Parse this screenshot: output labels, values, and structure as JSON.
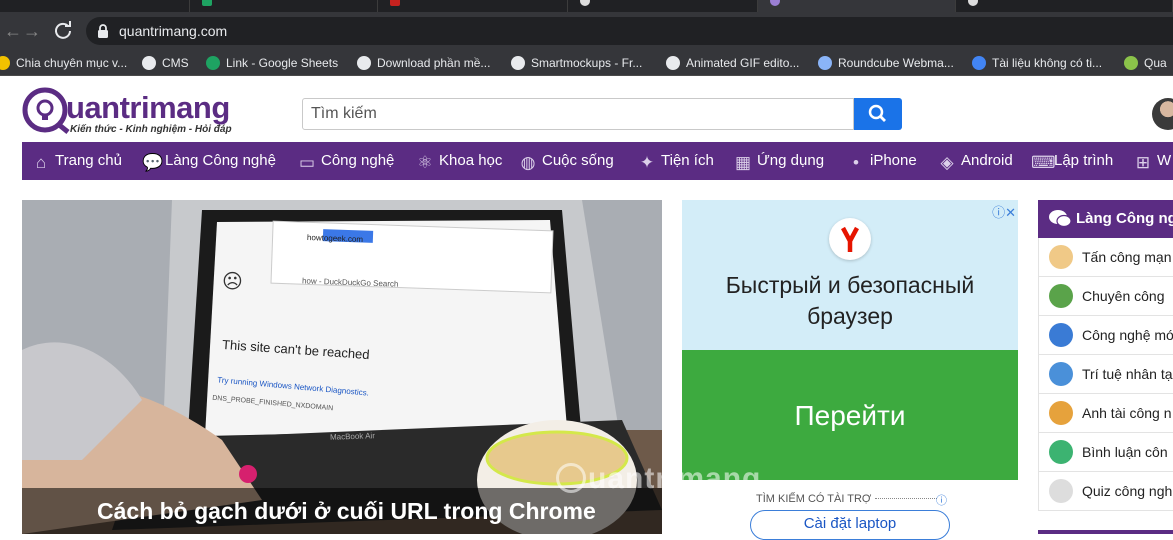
{
  "browser": {
    "url": "quantrimang.com",
    "bookmarks": [
      {
        "label": "Chia chuyên mục v...",
        "color": "#f2c200"
      },
      {
        "label": "CMS",
        "color": "#e8eaed"
      },
      {
        "label": "Link - Google Sheets",
        "color": "#1ea362"
      },
      {
        "label": "Download phần mề...",
        "color": "#e8eaed"
      },
      {
        "label": "Smartmockups - Fr...",
        "color": "#e8eaed"
      },
      {
        "label": "Animated GIF edito...",
        "color": "#e8eaed"
      },
      {
        "label": "Roundcube Webma...",
        "color": "#8ab4f8"
      },
      {
        "label": "Tài liệu không có ti...",
        "color": "#4285f4"
      },
      {
        "label": "Qua",
        "color": "#8bc34a"
      }
    ]
  },
  "site": {
    "logo_main": "uantrimang",
    "logo_tagline": "Kiến thức - Kinh nghiệm - Hỏi đáp",
    "search_placeholder": "Tìm kiếm",
    "nav": [
      {
        "label": "Trang chủ",
        "icon": "home-icon"
      },
      {
        "label": "Làng Công nghệ",
        "icon": "chat-bubbles-icon"
      },
      {
        "label": "Công nghệ",
        "icon": "monitor-icon"
      },
      {
        "label": "Khoa học",
        "icon": "atom-icon"
      },
      {
        "label": "Cuộc sống",
        "icon": "globe-icon"
      },
      {
        "label": "Tiện ích",
        "icon": "tools-icon"
      },
      {
        "label": "Ứng dụng",
        "icon": "apps-grid-icon"
      },
      {
        "label": "iPhone",
        "icon": "apple-icon"
      },
      {
        "label": "Android",
        "icon": "android-icon"
      },
      {
        "label": "Lập trình",
        "icon": "code-icon"
      },
      {
        "label": "W",
        "icon": "windows-icon"
      }
    ],
    "hero": {
      "title": "Cách bỏ gạch dưới ở cuối URL trong Chrome",
      "screen_title": "This site can't be reached",
      "screen_url": "howtogeek.com",
      "screen_error": "DNS_PROBE_FINISHED_NXDOMAIN",
      "screen_suggest": "how - DuckDuckGo Search",
      "screen_hint": "Try running Windows Network Diagnostics.",
      "laptop_brand": "MacBook Air"
    },
    "ad": {
      "headline": "Быстрый и безопасный браузер",
      "cta": "Перейти",
      "sponsor_label": "TÌM KIẾM CÓ TÀI TRỢ",
      "pill": "Cài đặt laptop"
    },
    "sidebar": {
      "title": "Làng Công ng",
      "items": [
        {
          "label": "Tấn công mạn",
          "color": "#f0c987"
        },
        {
          "label": "Chuyên công",
          "color": "#5aa34a"
        },
        {
          "label": "Công nghệ mớ",
          "color": "#3a7bd5"
        },
        {
          "label": "Trí tuệ nhân tạ",
          "color": "#4a90d9"
        },
        {
          "label": "Anh tài công n",
          "color": "#e6a23c"
        },
        {
          "label": "Bình luận côn",
          "color": "#3cb371"
        },
        {
          "label": "Quiz công ngh",
          "color": "#dddddd"
        }
      ]
    },
    "watermark": "uantrimang"
  }
}
